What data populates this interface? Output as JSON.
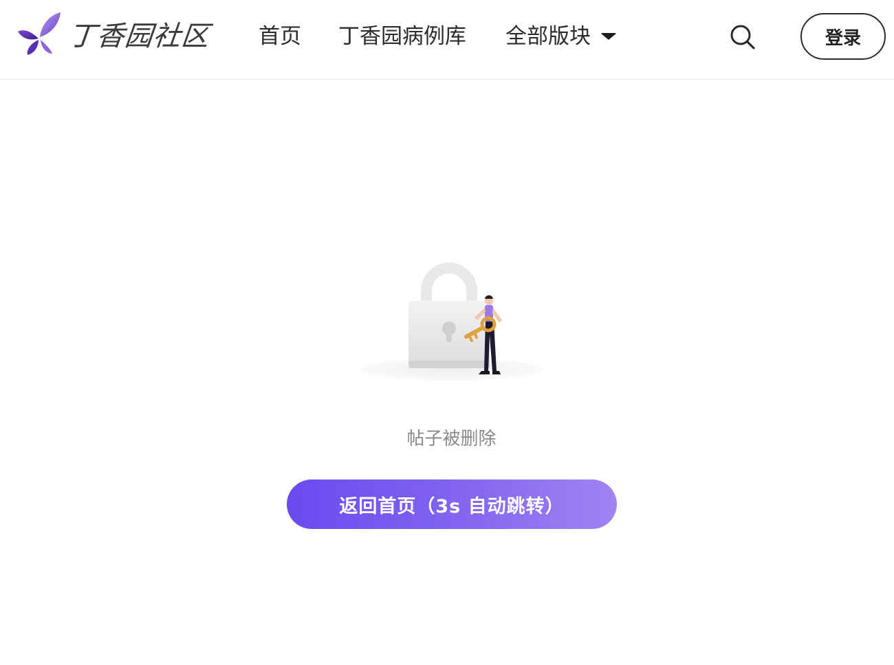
{
  "header": {
    "logo_text": "丁香园社区",
    "nav": {
      "home_label": "首页",
      "cases_label": "丁香园病例库",
      "all_sections_label": "全部版块"
    },
    "login_label": "登录"
  },
  "main": {
    "message": "帖子被删除",
    "home_button_label": "返回首页（3s 自动跳转）"
  },
  "colors": {
    "brand_purple": "#6a4af0",
    "button_gradient_end": "#a084f2",
    "message_gray": "#8a8a8a"
  },
  "icons": {
    "logo": "butterfly-logo-icon",
    "dropdown": "caret-down-icon",
    "search": "search-icon",
    "illustration": "locked-padlock-with-key-illustration"
  }
}
